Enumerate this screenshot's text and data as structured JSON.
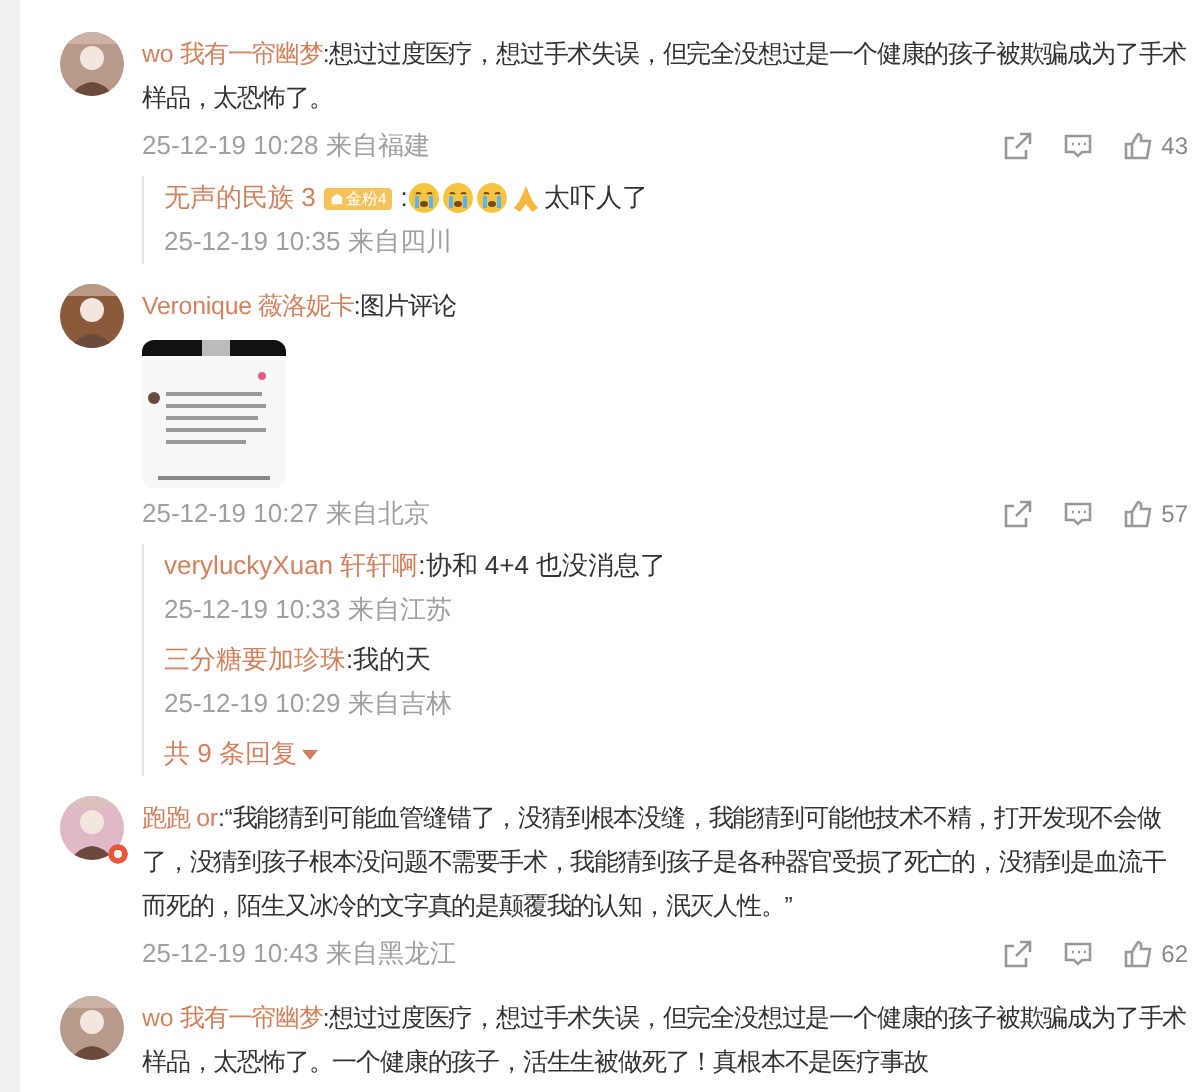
{
  "comments": [
    {
      "author": "wo 我有一帘幽梦",
      "text": ":想过过度医疗，想过手术失误，但完全没想过是一个健康的孩子被欺骗成为了手术样品，太恐怖了。",
      "time": "25-12-19 10:28 来自福建",
      "likes": "43",
      "verified": false,
      "replies": [
        {
          "author": "无声的民族 3",
          "badge": "金粉4",
          "content": [
            {
              "kind": "text",
              "text": ":"
            },
            {
              "kind": "cry"
            },
            {
              "kind": "cry"
            },
            {
              "kind": "cry"
            },
            {
              "kind": "pray"
            },
            {
              "kind": "text",
              "text": "太吓人了"
            }
          ],
          "time": "25-12-19 10:35 来自四川"
        }
      ]
    },
    {
      "author": "Veronique 薇洛妮卡",
      "text": ":图片评论",
      "time": "25-12-19 10:27 来自北京",
      "likes": "57",
      "verified": false,
      "replies": [
        {
          "author": "veryluckyXuan 轩轩啊",
          "content": [
            {
              "kind": "text",
              "text": ":协和 4+4 也没消息了"
            }
          ],
          "time": "25-12-19 10:33 来自江苏"
        },
        {
          "author": "三分糖要加珍珠",
          "content": [
            {
              "kind": "text",
              "text": ":我的天"
            }
          ],
          "time": "25-12-19 10:29 来自吉林"
        }
      ],
      "more": "共 9 条回复"
    },
    {
      "author": "跑跑 or",
      "text": ":“我能猜到可能血管缝错了，没猜到根本没缝，我能猜到可能他技术不精，打开发现不会做了，没猜到孩子根本没问题不需要手术，我能猜到孩子是各种器官受损了死亡的，没猜到是血流干而死的，陌生又冰冷的文字真的是颠覆我的认知，泯灭人性。”",
      "time": "25-12-19 10:43 来自黑龙江",
      "likes": "62",
      "verified": true
    },
    {
      "author": "wo 我有一帘幽梦",
      "text": ":想过过度医疗，想过手术失误，但完全没想过是一个健康的孩子被欺骗成为了手术样品，太恐怖了。一个健康的孩子，活生生被做死了！真根本不是医疗事故",
      "verified": false
    }
  ]
}
